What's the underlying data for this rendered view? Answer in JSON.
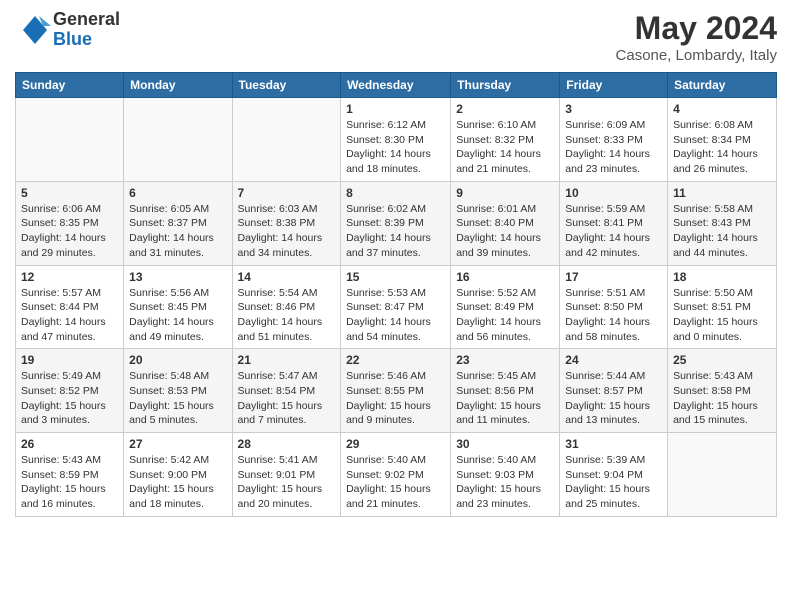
{
  "logo": {
    "general": "General",
    "blue": "Blue"
  },
  "header": {
    "month": "May 2024",
    "location": "Casone, Lombardy, Italy"
  },
  "weekdays": [
    "Sunday",
    "Monday",
    "Tuesday",
    "Wednesday",
    "Thursday",
    "Friday",
    "Saturday"
  ],
  "weeks": [
    [
      {
        "day": "",
        "info": ""
      },
      {
        "day": "",
        "info": ""
      },
      {
        "day": "",
        "info": ""
      },
      {
        "day": "1",
        "info": "Sunrise: 6:12 AM\nSunset: 8:30 PM\nDaylight: 14 hours\nand 18 minutes."
      },
      {
        "day": "2",
        "info": "Sunrise: 6:10 AM\nSunset: 8:32 PM\nDaylight: 14 hours\nand 21 minutes."
      },
      {
        "day": "3",
        "info": "Sunrise: 6:09 AM\nSunset: 8:33 PM\nDaylight: 14 hours\nand 23 minutes."
      },
      {
        "day": "4",
        "info": "Sunrise: 6:08 AM\nSunset: 8:34 PM\nDaylight: 14 hours\nand 26 minutes."
      }
    ],
    [
      {
        "day": "5",
        "info": "Sunrise: 6:06 AM\nSunset: 8:35 PM\nDaylight: 14 hours\nand 29 minutes."
      },
      {
        "day": "6",
        "info": "Sunrise: 6:05 AM\nSunset: 8:37 PM\nDaylight: 14 hours\nand 31 minutes."
      },
      {
        "day": "7",
        "info": "Sunrise: 6:03 AM\nSunset: 8:38 PM\nDaylight: 14 hours\nand 34 minutes."
      },
      {
        "day": "8",
        "info": "Sunrise: 6:02 AM\nSunset: 8:39 PM\nDaylight: 14 hours\nand 37 minutes."
      },
      {
        "day": "9",
        "info": "Sunrise: 6:01 AM\nSunset: 8:40 PM\nDaylight: 14 hours\nand 39 minutes."
      },
      {
        "day": "10",
        "info": "Sunrise: 5:59 AM\nSunset: 8:41 PM\nDaylight: 14 hours\nand 42 minutes."
      },
      {
        "day": "11",
        "info": "Sunrise: 5:58 AM\nSunset: 8:43 PM\nDaylight: 14 hours\nand 44 minutes."
      }
    ],
    [
      {
        "day": "12",
        "info": "Sunrise: 5:57 AM\nSunset: 8:44 PM\nDaylight: 14 hours\nand 47 minutes."
      },
      {
        "day": "13",
        "info": "Sunrise: 5:56 AM\nSunset: 8:45 PM\nDaylight: 14 hours\nand 49 minutes."
      },
      {
        "day": "14",
        "info": "Sunrise: 5:54 AM\nSunset: 8:46 PM\nDaylight: 14 hours\nand 51 minutes."
      },
      {
        "day": "15",
        "info": "Sunrise: 5:53 AM\nSunset: 8:47 PM\nDaylight: 14 hours\nand 54 minutes."
      },
      {
        "day": "16",
        "info": "Sunrise: 5:52 AM\nSunset: 8:49 PM\nDaylight: 14 hours\nand 56 minutes."
      },
      {
        "day": "17",
        "info": "Sunrise: 5:51 AM\nSunset: 8:50 PM\nDaylight: 14 hours\nand 58 minutes."
      },
      {
        "day": "18",
        "info": "Sunrise: 5:50 AM\nSunset: 8:51 PM\nDaylight: 15 hours\nand 0 minutes."
      }
    ],
    [
      {
        "day": "19",
        "info": "Sunrise: 5:49 AM\nSunset: 8:52 PM\nDaylight: 15 hours\nand 3 minutes."
      },
      {
        "day": "20",
        "info": "Sunrise: 5:48 AM\nSunset: 8:53 PM\nDaylight: 15 hours\nand 5 minutes."
      },
      {
        "day": "21",
        "info": "Sunrise: 5:47 AM\nSunset: 8:54 PM\nDaylight: 15 hours\nand 7 minutes."
      },
      {
        "day": "22",
        "info": "Sunrise: 5:46 AM\nSunset: 8:55 PM\nDaylight: 15 hours\nand 9 minutes."
      },
      {
        "day": "23",
        "info": "Sunrise: 5:45 AM\nSunset: 8:56 PM\nDaylight: 15 hours\nand 11 minutes."
      },
      {
        "day": "24",
        "info": "Sunrise: 5:44 AM\nSunset: 8:57 PM\nDaylight: 15 hours\nand 13 minutes."
      },
      {
        "day": "25",
        "info": "Sunrise: 5:43 AM\nSunset: 8:58 PM\nDaylight: 15 hours\nand 15 minutes."
      }
    ],
    [
      {
        "day": "26",
        "info": "Sunrise: 5:43 AM\nSunset: 8:59 PM\nDaylight: 15 hours\nand 16 minutes."
      },
      {
        "day": "27",
        "info": "Sunrise: 5:42 AM\nSunset: 9:00 PM\nDaylight: 15 hours\nand 18 minutes."
      },
      {
        "day": "28",
        "info": "Sunrise: 5:41 AM\nSunset: 9:01 PM\nDaylight: 15 hours\nand 20 minutes."
      },
      {
        "day": "29",
        "info": "Sunrise: 5:40 AM\nSunset: 9:02 PM\nDaylight: 15 hours\nand 21 minutes."
      },
      {
        "day": "30",
        "info": "Sunrise: 5:40 AM\nSunset: 9:03 PM\nDaylight: 15 hours\nand 23 minutes."
      },
      {
        "day": "31",
        "info": "Sunrise: 5:39 AM\nSunset: 9:04 PM\nDaylight: 15 hours\nand 25 minutes."
      },
      {
        "day": "",
        "info": ""
      }
    ]
  ]
}
